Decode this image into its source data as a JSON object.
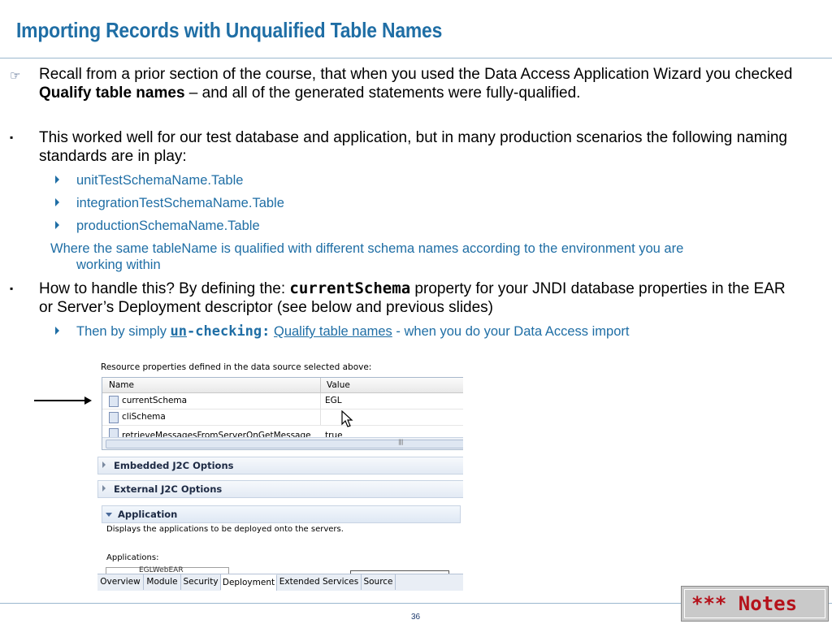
{
  "slide": {
    "title": "Importing Records with Unqualified Table Names",
    "page_number": "36",
    "notes_button": "*** Notes",
    "accent_color": "#1f6ea5",
    "notes_color": "#b5121b"
  },
  "bullets": {
    "b1": {
      "marker": "☞",
      "pre": "Recall from a prior section of the course, that when you used the Data Access Application Wizard you checked ",
      "bold": "Qualify table names",
      "post": " – and all of the generated statements were fully-qualified."
    },
    "b2": {
      "marker": "▪",
      "text": "This worked well for our test database and application, but in many production scenarios the following naming standards are in play:",
      "sub": [
        "unitTestSchemaName.Table",
        "integrationTestSchemaName.Table",
        "productionSchemaName.Table"
      ],
      "note_line1": "Where the same tableName is qualified with different schema names according to the environment you are",
      "note_line2": "working within"
    },
    "b3": {
      "marker": "▪",
      "pre": "How to handle this?  By defining the:  ",
      "code": "currentSchema",
      "post": " property for your JNDI database properties in the EAR or Server’s Deployment descriptor (see below and previous slides)",
      "sub_pre": "Then by simply ",
      "sub_un": "un",
      "sub_checking": "-checking:",
      "sub_qtn": "Qualify table names",
      "sub_post": "  - when you do your Data Access import"
    }
  },
  "screenshot": {
    "header": "Resource properties defined in the data source selected above:",
    "columns": {
      "name": "Name",
      "value": "Value"
    },
    "rows": [
      {
        "name": "currentSchema",
        "value": "EGL"
      },
      {
        "name": "cliSchema",
        "value": ""
      },
      {
        "name": "retrieveMessagesFromServerOnGetMessage",
        "value": "true"
      }
    ],
    "sections": {
      "embedded": "Embedded J2C Options",
      "external": "External J2C Options",
      "application": "Application"
    },
    "app_desc": "Displays the applications to be deployed onto the servers.",
    "applications_label": "Applications:",
    "app_item": "EGLWebEAR",
    "tabs": [
      "Overview",
      "Module",
      "Security",
      "Deployment",
      "Extended Services",
      "Source"
    ],
    "active_tab": "Deployment"
  }
}
